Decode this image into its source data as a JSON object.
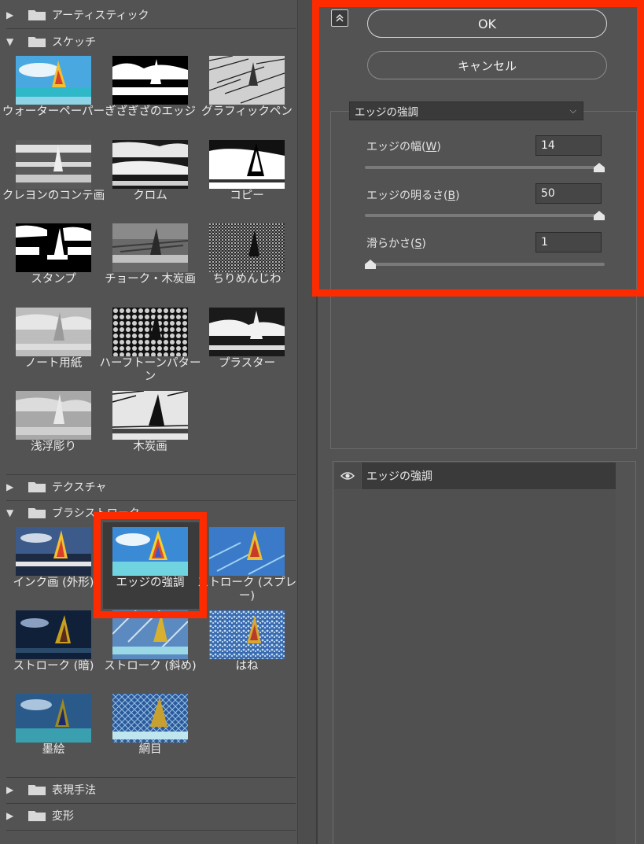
{
  "left_panel": {
    "categories": {
      "artistic": "アーティスティック",
      "sketch": "スケッチ",
      "texture": "テクスチャ",
      "brush_strokes": "ブラシストローク",
      "stylize": "表現手法",
      "distort": "変形"
    },
    "sketch_filters": [
      "ウォーターペーパー",
      "ぎざぎざのエッジ",
      "グラフィックペン",
      "クレヨンのコンテ画",
      "クロム",
      "コピー",
      "スタンプ",
      "チョーク・木炭画",
      "ちりめんじわ",
      "ノート用紙",
      "ハーフトーンパターン",
      "プラスター",
      "浅浮彫り",
      "木炭画"
    ],
    "brush_filters": [
      "インク画 (外形)",
      "エッジの強調",
      "ストローク (スプレー)",
      "ストローク (暗)",
      "ストローク (斜め)",
      "はね",
      "墨絵",
      "網目"
    ],
    "selected_filter": "エッジの強調"
  },
  "right_panel": {
    "ok_label": "OK",
    "cancel_label": "キャンセル",
    "filter_select_value": "エッジの強調",
    "params": {
      "edge_width": {
        "label_pre": "エッジの幅(",
        "key": "W",
        "label_post": ")",
        "value": "14",
        "max": 14,
        "level": 1.0
      },
      "edge_brightness": {
        "label_pre": "エッジの明るさ(",
        "key": "B",
        "label_post": ")",
        "value": "50",
        "max": 50,
        "level": 1.0
      },
      "smoothness": {
        "label_pre": "滑らかさ(",
        "key": "S",
        "label_post": ")",
        "value": "1",
        "max": 15,
        "level": 0.0
      }
    }
  },
  "layers": {
    "active_layer_name": "エッジの強調"
  },
  "colors": {
    "highlight_red": "#ff2b00",
    "panel_bg": "#535353",
    "dark_bg": "#3a3a3a"
  }
}
